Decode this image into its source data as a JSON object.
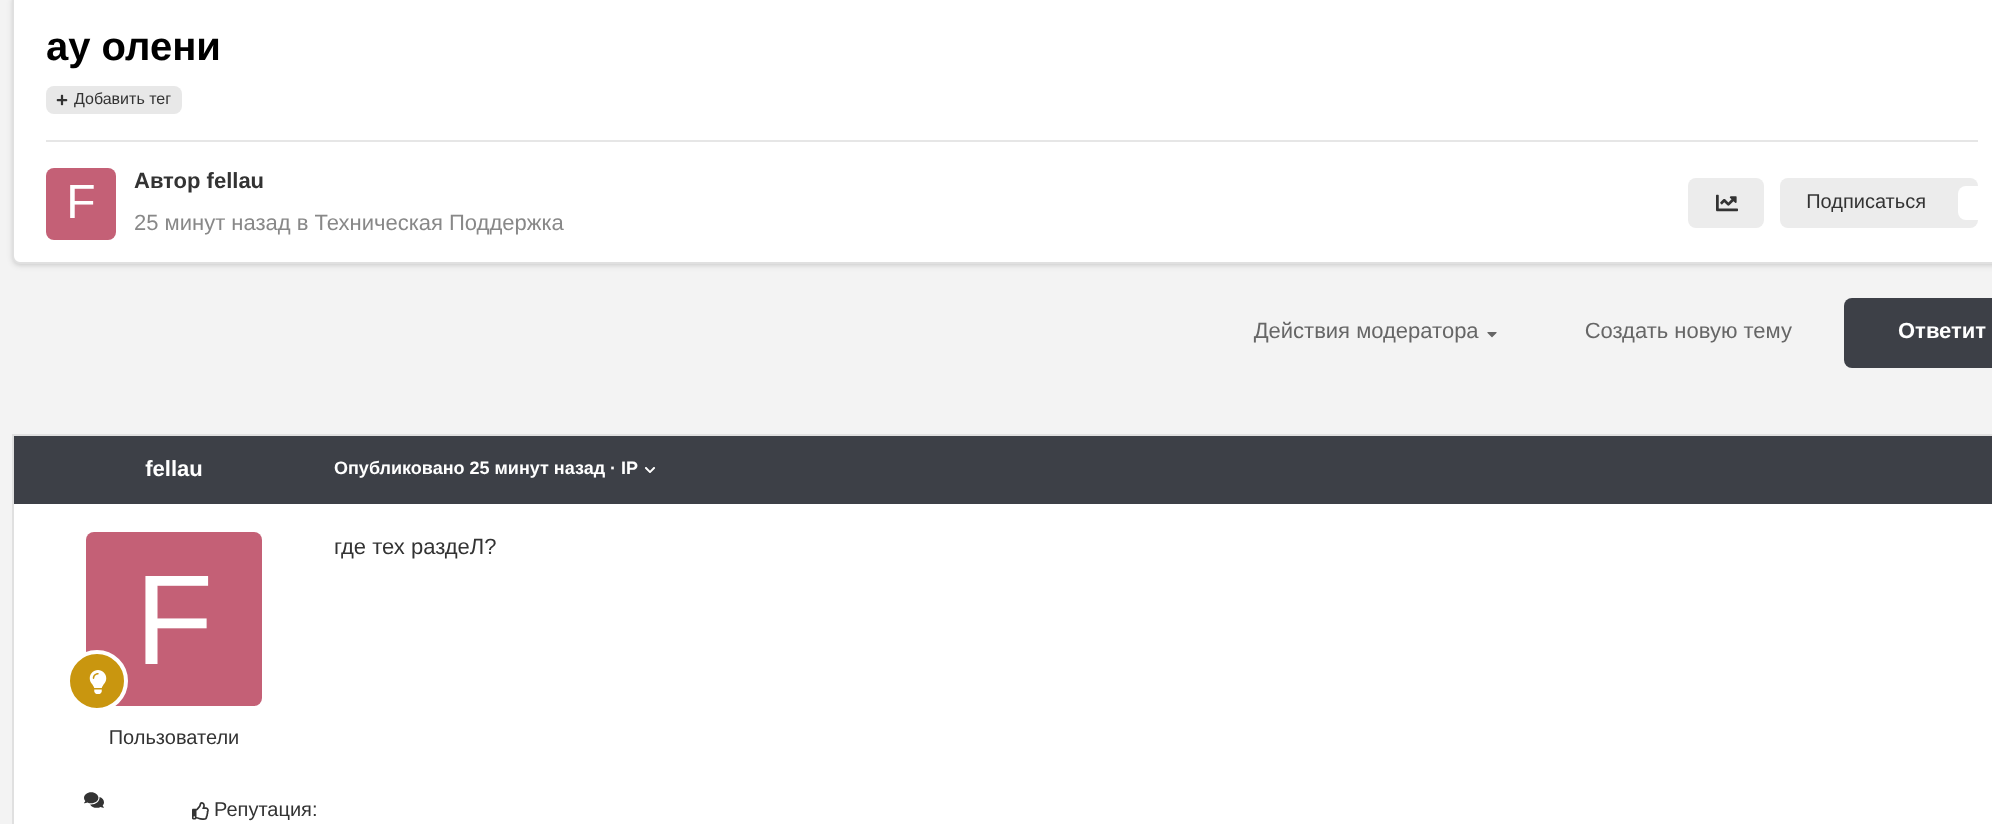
{
  "topic": {
    "title": "ау олени",
    "add_tag": "Добавить тег",
    "author_initial": "F",
    "author_line": "Автор fellau",
    "meta": "25 минут назад в Техническая Поддержка",
    "subscribe": "Подписаться"
  },
  "actions": {
    "moderator": "Действия модератора",
    "new_topic": "Создать новую тему",
    "reply": "Ответит"
  },
  "post": {
    "author": "fellau",
    "published": "Опубликовано 25 минут назад · IP",
    "avatar_initial": "F",
    "text": "где тех раздеЛ?",
    "group": "Пользователи",
    "reputation": "Репутация:"
  }
}
